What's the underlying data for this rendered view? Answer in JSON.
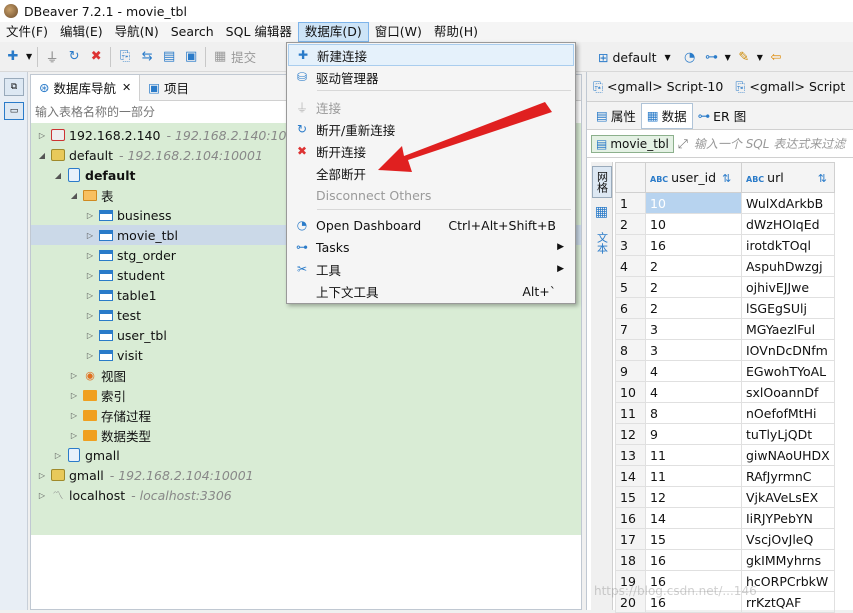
{
  "window": {
    "title": "DBeaver 7.2.1 - movie_tbl"
  },
  "menubar": {
    "items": [
      "文件(F)",
      "编辑(E)",
      "导航(N)",
      "Search",
      "SQL 编辑器",
      "数据库(D)",
      "窗口(W)",
      "帮助(H)"
    ]
  },
  "toolbar": {
    "submit_label": "提交",
    "datasource": "default"
  },
  "navigator": {
    "tab_db": "数据库导航",
    "tab_project": "项目",
    "filter_placeholder": "输入表格名称的一部分",
    "nodes": {
      "conn1": {
        "name": "192.168.2.140",
        "host": "- 192.168.2.140:10000"
      },
      "conn2": {
        "name": "default",
        "host": "- 192.168.2.104:10001"
      },
      "db_default": "default",
      "tables_folder": "表",
      "tables": [
        "business",
        "movie_tbl",
        "stg_order",
        "student",
        "table1",
        "test",
        "user_tbl",
        "visit"
      ],
      "views": "视图",
      "indexes": "索引",
      "procedures": "存储过程",
      "datatypes": "数据类型",
      "gmall_db": "gmall",
      "conn3": {
        "name": "gmall",
        "host": "- 192.168.2.104:10001"
      },
      "conn4": {
        "name": "localhost",
        "host": "- localhost:3306"
      }
    }
  },
  "database_menu": {
    "new_connection": "新建连接",
    "driver_manager": "驱动管理器",
    "connect": "连接",
    "reconnect": "断开/重新连接",
    "disconnect": "断开连接",
    "disconnect_all": "全部断开",
    "disconnect_others": "Disconnect Others",
    "open_dashboard": "Open Dashboard",
    "open_dashboard_shortcut": "Ctrl+Alt+Shift+B",
    "tasks": "Tasks",
    "tools": "工具",
    "context_tools": "上下文工具",
    "context_tools_shortcut": "Alt+`"
  },
  "editor": {
    "tab1": "<gmall> Script-10",
    "tab2": "<gmall> Script",
    "subtab_props": "属性",
    "subtab_data": "数据",
    "subtab_er": "ER 图",
    "table_chip": "movie_tbl",
    "filter_placeholder": "输入一个 SQL 表达式来过滤",
    "side_grid": "网格",
    "side_text": "文本",
    "col1": "user_id",
    "col2": "url",
    "rows": [
      {
        "n": "1",
        "user_id": "10",
        "url": "WulXdArkbB"
      },
      {
        "n": "2",
        "user_id": "10",
        "url": "dWzHOIqEd"
      },
      {
        "n": "3",
        "user_id": "16",
        "url": "irotdkTOql"
      },
      {
        "n": "4",
        "user_id": "2",
        "url": "AspuhDwzgj"
      },
      {
        "n": "5",
        "user_id": "2",
        "url": "ojhivEJJwe"
      },
      {
        "n": "6",
        "user_id": "2",
        "url": "lSGEgSUlj"
      },
      {
        "n": "7",
        "user_id": "3",
        "url": "MGYaezlFul"
      },
      {
        "n": "8",
        "user_id": "3",
        "url": "IOVnDcDNfm"
      },
      {
        "n": "9",
        "user_id": "4",
        "url": "EGwohTYoAL"
      },
      {
        "n": "10",
        "user_id": "4",
        "url": "sxlOoannDf"
      },
      {
        "n": "11",
        "user_id": "8",
        "url": "nOefofMtHi"
      },
      {
        "n": "12",
        "user_id": "9",
        "url": "tuTlyLjQDt"
      },
      {
        "n": "13",
        "user_id": "11",
        "url": "giwNAoUHDX"
      },
      {
        "n": "14",
        "user_id": "11",
        "url": "RAfJyrmnC"
      },
      {
        "n": "15",
        "user_id": "12",
        "url": "VjkAVeLsEX"
      },
      {
        "n": "16",
        "user_id": "14",
        "url": "IiRJYPebYN"
      },
      {
        "n": "17",
        "user_id": "15",
        "url": "VscjOvJleQ"
      },
      {
        "n": "18",
        "user_id": "16",
        "url": "gkIMMyhrns"
      },
      {
        "n": "19",
        "user_id": "16",
        "url": "hcORPCrbkW"
      },
      {
        "n": "20",
        "user_id": "16",
        "url": "rrKztQAF"
      }
    ]
  },
  "watermark": "https://blog.csdn.net/...146"
}
